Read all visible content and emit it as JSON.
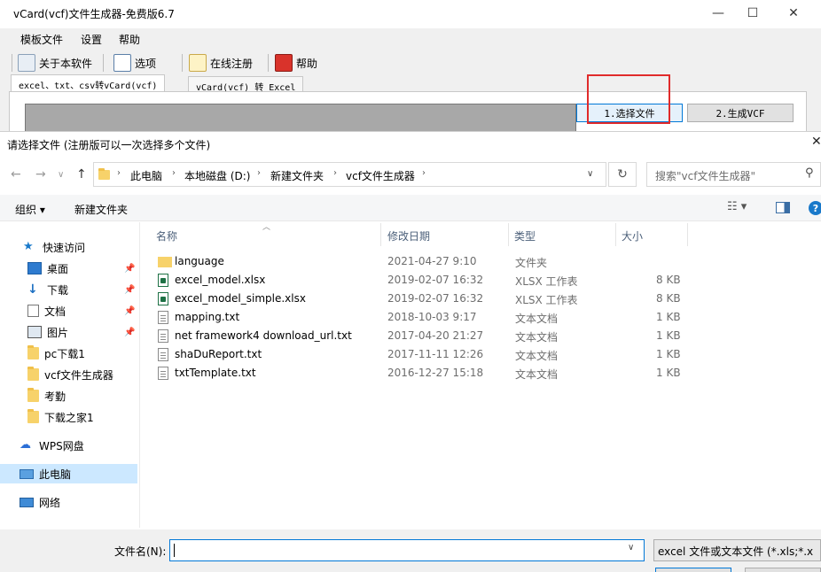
{
  "app": {
    "title": "vCard(vcf)文件生成器-免费版6.7",
    "menu": [
      "模板文件",
      "设置",
      "帮助"
    ],
    "toolbar": [
      "关于本软件",
      "选项",
      "在线注册",
      "帮助"
    ],
    "tabs": [
      "excel、txt、csv转vCard(vcf)",
      "vCard(vcf) 转 Excel"
    ],
    "btn_select": "1.选择文件",
    "btn_generate": "2.生成VCF",
    "window_controls": {
      "minimize": "—",
      "maximize": "☐",
      "close": "✕"
    }
  },
  "dialog": {
    "title": "请选择文件 (注册版可以一次选择多个文件)",
    "close": "✕",
    "breadcrumb": [
      "此电脑",
      "本地磁盘 (D:)",
      "新建文件夹",
      "vcf文件生成器"
    ],
    "search_placeholder": "搜索\"vcf文件生成器\"",
    "commands": {
      "organize": "组织 ▾",
      "new_folder": "新建文件夹"
    },
    "nav": [
      {
        "label": "快速访问",
        "icon": "star-icon"
      },
      {
        "label": "桌面",
        "icon": "desktop-icon",
        "pinned": true
      },
      {
        "label": "下载",
        "icon": "download-icon",
        "pinned": true
      },
      {
        "label": "文档",
        "icon": "document-icon",
        "pinned": true
      },
      {
        "label": "图片",
        "icon": "picture-icon",
        "pinned": true
      },
      {
        "label": "pc下载1",
        "icon": "folder-icon"
      },
      {
        "label": "vcf文件生成器",
        "icon": "folder-icon"
      },
      {
        "label": "考勤",
        "icon": "folder-icon"
      },
      {
        "label": "下载之家1",
        "icon": "folder-icon"
      },
      {
        "label": "WPS网盘",
        "icon": "cloud-icon"
      },
      {
        "label": "此电脑",
        "icon": "computer-icon",
        "selected": true
      },
      {
        "label": "网络",
        "icon": "network-icon"
      }
    ],
    "columns": {
      "name": "名称",
      "date": "修改日期",
      "type": "类型",
      "size": "大小"
    },
    "files": [
      {
        "name": "language",
        "date": "2021-04-27 9:10",
        "type": "文件夹",
        "size": "",
        "kind": "folder"
      },
      {
        "name": "excel_model.xlsx",
        "date": "2019-02-07 16:32",
        "type": "XLSX 工作表",
        "size": "8 KB",
        "kind": "xlsx"
      },
      {
        "name": "excel_model_simple.xlsx",
        "date": "2019-02-07 16:32",
        "type": "XLSX 工作表",
        "size": "8 KB",
        "kind": "xlsx"
      },
      {
        "name": "mapping.txt",
        "date": "2018-10-03 9:17",
        "type": "文本文档",
        "size": "1 KB",
        "kind": "txt"
      },
      {
        "name": "net framework4 download_url.txt",
        "date": "2017-04-20 21:27",
        "type": "文本文档",
        "size": "1 KB",
        "kind": "txt"
      },
      {
        "name": "shaDuReport.txt",
        "date": "2017-11-11 12:26",
        "type": "文本文档",
        "size": "1 KB",
        "kind": "txt"
      },
      {
        "name": "txtTemplate.txt",
        "date": "2016-12-27 15:18",
        "type": "文本文档",
        "size": "1 KB",
        "kind": "txt"
      }
    ],
    "filename_label": "文件名(N):",
    "filename_value": "",
    "filter": "excel 文件或文本文件 (*.xls;*.x"
  },
  "colors": {
    "highlight": "#e02b2b",
    "accent": "#0078d7",
    "selected_bg": "#cce8ff"
  }
}
